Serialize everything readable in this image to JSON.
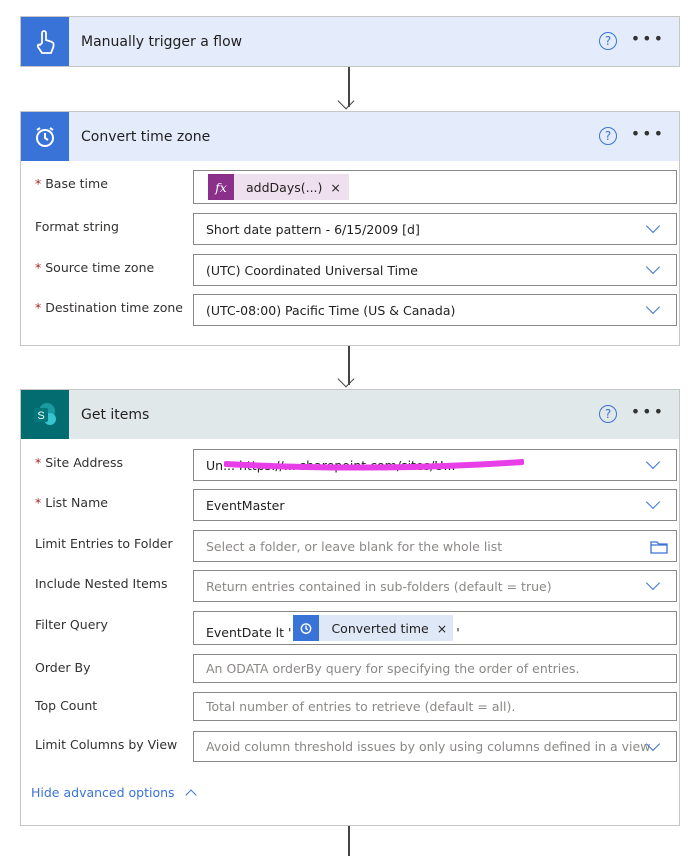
{
  "trigger": {
    "title": "Manually trigger a flow",
    "icon": "hand-touch-icon",
    "color": "#3a73d8"
  },
  "convert": {
    "title": "Convert time zone",
    "icon": "alarm-clock-icon",
    "color": "#3a73d8",
    "fields": [
      {
        "label": "Base time",
        "required": true,
        "token": "addDays(...)",
        "token_icon": "fx-icon",
        "token_color": "#8a2f8a"
      },
      {
        "label": "Format string",
        "required": false,
        "value": "Short date pattern - 6/15/2009 [d]"
      },
      {
        "label": "Source time zone",
        "required": true,
        "value": "(UTC) Coordinated Universal Time"
      },
      {
        "label": "Destination time zone",
        "required": true,
        "value": "(UTC-08:00) Pacific Time (US & Canada)"
      }
    ]
  },
  "getitems": {
    "title": "Get items",
    "icon": "sharepoint-icon",
    "color": "#036c70",
    "fields": [
      {
        "label": "Site Address",
        "required": true,
        "value": "Un... https://... sharepoint.com/sites/U..."
      },
      {
        "label": "List Name",
        "required": true,
        "value": "EventMaster"
      },
      {
        "label": "Limit Entries to Folder",
        "placeholder": "Select a folder, or leave blank for the whole list"
      },
      {
        "label": "Include Nested Items",
        "placeholder": "Return entries contained in sub-folders (default = true)"
      },
      {
        "label": "Filter Query",
        "prefix": "EventDate lt '",
        "token": "Converted time",
        "suffix": "'"
      },
      {
        "label": "Order By",
        "placeholder": "An ODATA orderBy query for specifying the order of entries."
      },
      {
        "label": "Top Count",
        "placeholder": "Total number of entries to retrieve (default = all)."
      },
      {
        "label": "Limit Columns by View",
        "placeholder": "Avoid column threshold issues by only using columns defined in a view"
      }
    ],
    "hide_advanced": "Hide advanced options"
  },
  "help_symbol": "?",
  "more_symbol": "•••",
  "asterisk": "*",
  "close_symbol": "×"
}
